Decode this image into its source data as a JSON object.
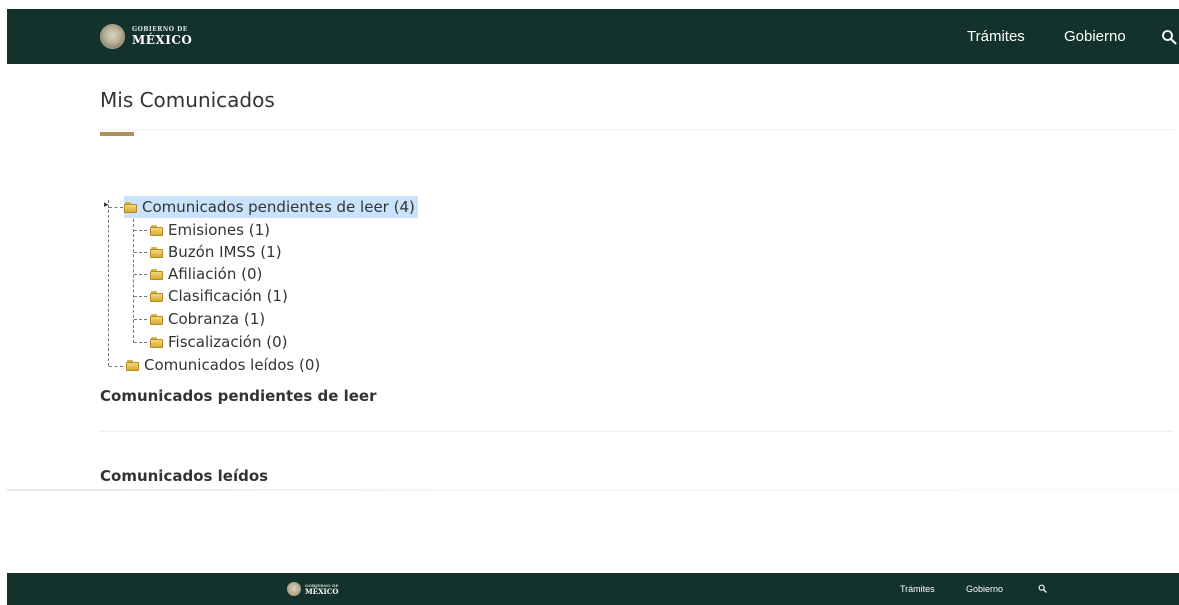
{
  "header": {
    "logo_small": "GOBIERNO DE",
    "logo_big": "MÉXICO",
    "nav": [
      "Trámites",
      "Gobierno"
    ],
    "search_icon": "search-icon"
  },
  "main": {
    "title": "Mis Comunicados",
    "accent_color": "#b38e5d",
    "tree": {
      "root": "Comunicados pendientes de leer (4)",
      "children": [
        "Emisiones (1)",
        "Buzón IMSS (1)",
        "Afiliación (0)",
        "Clasificación (1)",
        "Cobranza (1)",
        "Fiscalización (0)"
      ],
      "read": "Comunicados leídos (0)"
    },
    "sections": [
      "Comunicados pendientes de leer",
      "Comunicados leídos"
    ]
  },
  "footer": {
    "logo_small": "GOBIERNO DE",
    "logo_big": "MÉXICO",
    "nav": [
      "Trámites",
      "Gobierno"
    ]
  },
  "colors": {
    "bar": "#13322b",
    "selected": "#c8e3fb"
  }
}
